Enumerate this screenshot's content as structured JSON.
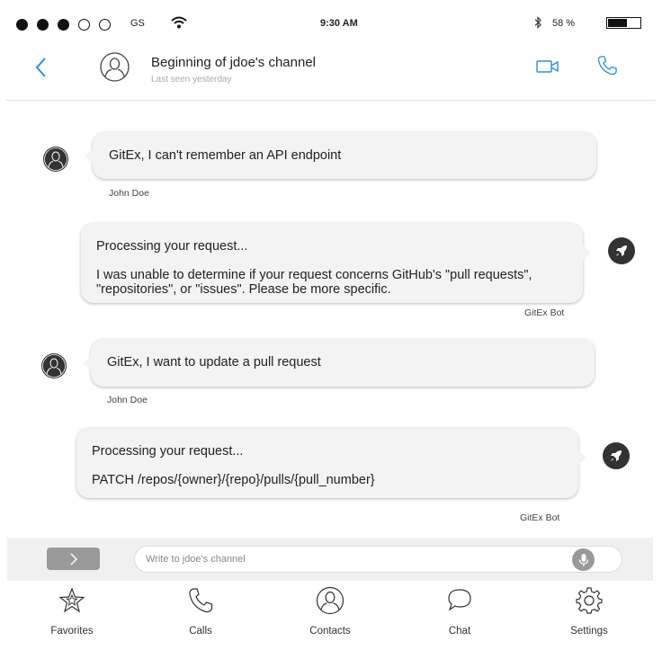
{
  "status_bar": {
    "carrier": "GS",
    "time": "9:30 AM",
    "battery_percent": "58 %",
    "battery_level": 0.58,
    "signal_dots_filled": 3,
    "signal_dots_total": 5
  },
  "header": {
    "title": "Beginning of jdoe's channel",
    "subtitle": "Last seen yesterday",
    "accent_color": "#2a8fd8"
  },
  "messages": [
    {
      "sender": "John Doe",
      "lines": [
        "GitEx, I can't remember an API endpoint"
      ]
    },
    {
      "sender": "GitEx Bot",
      "lines": [
        "Processing your request...",
        "I was unable to determine if your request concerns GitHub's \"pull requests\", \"repositories\", or \"issues\". Please be more specific."
      ]
    },
    {
      "sender": "John Doe",
      "lines": [
        "GitEx, I want to update a pull request"
      ]
    },
    {
      "sender": "GitEx Bot",
      "lines": [
        "Processing your request...",
        "PATCH /repos/{owner}/{repo}/pulls/{pull_number}"
      ]
    }
  ],
  "composer": {
    "placeholder": "Write to jdoe's channel",
    "send_icon": "chevron-right-icon",
    "mic_icon": "microphone-icon"
  },
  "tabs": [
    {
      "label": "Favorites",
      "icon": "star-icon"
    },
    {
      "label": "Calls",
      "icon": "phone-icon"
    },
    {
      "label": "Contacts",
      "icon": "user-circle-icon"
    },
    {
      "label": "Chat",
      "icon": "chat-bubble-icon"
    },
    {
      "label": "Settings",
      "icon": "gear-icon"
    }
  ]
}
